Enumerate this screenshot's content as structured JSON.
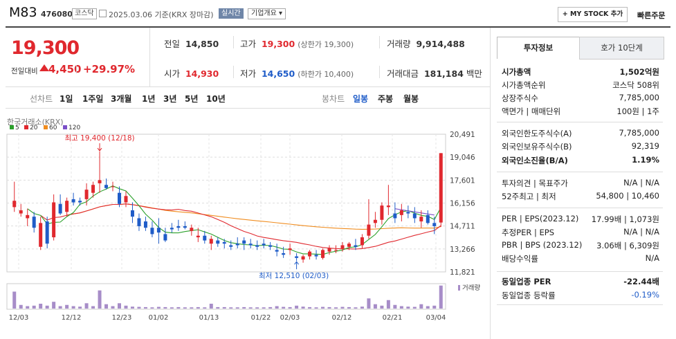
{
  "header": {
    "name": "M83",
    "code": "476080",
    "market": "코스닥",
    "date": "2025.03.06",
    "basis": "기준(KRX 장마감)",
    "realtime": "실시간",
    "company_info": "기업개요",
    "my_stock": "+ MY STOCK 추가",
    "quick_order": "빠른주문"
  },
  "price": {
    "current": "19,300",
    "change_label": "전일대비",
    "change": "4,450",
    "percent": "+29.97%"
  },
  "stats": {
    "prev_label": "전일",
    "prev": "14,850",
    "high_label": "고가",
    "high": "19,300",
    "high_limit": "(상한가 19,300)",
    "vol_label": "거래량",
    "vol": "9,914,488",
    "open_label": "시가",
    "open": "14,930",
    "low_label": "저가",
    "low": "14,650",
    "low_limit": "(하한가 10,400)",
    "amt_label": "거래대금",
    "amt": "181,184",
    "amt_unit": "백만"
  },
  "periods": {
    "left": [
      "선차트",
      "1일",
      "1주일",
      "3개월",
      "1년",
      "3년",
      "5년",
      "10년"
    ],
    "right": [
      "봉차트",
      "일봉",
      "주봉",
      "월봉"
    ]
  },
  "chart_legend": "한국거래소(KRX)",
  "chart_data": {
    "type": "candlestick",
    "ma": [
      {
        "name": "5",
        "color": "#2aa02a"
      },
      {
        "name": "20",
        "color": "#e0282e"
      },
      {
        "name": "60",
        "color": "#f08c1e"
      },
      {
        "name": "120",
        "color": "#7b4fc8"
      }
    ],
    "y_ticks": [
      "20,491",
      "19,046",
      "17,601",
      "16,156",
      "14,711",
      "13,266",
      "11,821"
    ],
    "x_ticks": [
      "12/03",
      "12/12",
      "12/23",
      "01/02",
      "01/13",
      "01/22",
      "02/03",
      "02/12",
      "02/21",
      "03/04"
    ],
    "high_note": "최고 19,400 (12/18)",
    "low_note": "최저 12,510 (02/03)",
    "volume_label": "거래량",
    "ylim": [
      11821,
      20491
    ],
    "candles": [
      [
        15900,
        17500,
        15600,
        16300
      ],
      [
        15500,
        16100,
        15300,
        15700
      ],
      [
        15200,
        15800,
        14700,
        15400
      ],
      [
        15300,
        15600,
        14300,
        14600
      ],
      [
        13400,
        15300,
        13200,
        14900
      ],
      [
        15000,
        15300,
        13300,
        13600
      ],
      [
        14000,
        16700,
        13800,
        16200
      ],
      [
        16100,
        16700,
        15400,
        15500
      ],
      [
        15600,
        16500,
        15300,
        16300
      ],
      [
        16400,
        16800,
        16000,
        16200
      ],
      [
        16300,
        16500,
        16000,
        16200
      ],
      [
        16400,
        17400,
        16000,
        17000
      ],
      [
        16800,
        17500,
        16500,
        17300
      ],
      [
        17400,
        19400,
        16800,
        17600
      ],
      [
        17300,
        17700,
        17000,
        17100
      ],
      [
        17200,
        17500,
        16900,
        17200
      ],
      [
        16800,
        17200,
        15900,
        16100
      ],
      [
        16200,
        16900,
        15900,
        16600
      ],
      [
        15700,
        16200,
        14900,
        15300
      ],
      [
        15200,
        15500,
        14400,
        14700
      ],
      [
        15000,
        15300,
        14400,
        14600
      ],
      [
        14600,
        15000,
        14000,
        14200
      ],
      [
        14600,
        15200,
        13600,
        14300
      ],
      [
        14200,
        14600,
        13700,
        13800
      ],
      [
        14600,
        14900,
        14300,
        14500
      ],
      [
        14700,
        15100,
        14400,
        14600
      ],
      [
        14700,
        15000,
        14500,
        14600
      ],
      [
        14400,
        14800,
        14100,
        14600
      ],
      [
        14000,
        14600,
        13700,
        14100
      ],
      [
        14100,
        14400,
        13600,
        13800
      ],
      [
        13600,
        14100,
        13200,
        13900
      ],
      [
        13800,
        14000,
        13400,
        13600
      ],
      [
        13700,
        13900,
        13300,
        13600
      ],
      [
        13500,
        13800,
        13200,
        13400
      ],
      [
        13600,
        14000,
        13300,
        13500
      ],
      [
        13800,
        14000,
        13200,
        13600
      ],
      [
        13600,
        13900,
        13300,
        13500
      ],
      [
        13500,
        13800,
        13200,
        13400
      ],
      [
        13600,
        13900,
        13300,
        13500
      ],
      [
        13500,
        13700,
        13200,
        13400
      ],
      [
        13200,
        13600,
        12800,
        13100
      ],
      [
        13000,
        13400,
        12700,
        12900
      ],
      [
        13200,
        13600,
        12900,
        13300
      ],
      [
        12800,
        13000,
        12510,
        12700
      ],
      [
        12600,
        12900,
        12400,
        12800
      ],
      [
        12800,
        13200,
        12600,
        13100
      ],
      [
        12900,
        13200,
        12600,
        12800
      ],
      [
        12700,
        13300,
        12600,
        13200
      ],
      [
        13100,
        13500,
        12900,
        13300
      ],
      [
        13200,
        13500,
        13000,
        13200
      ],
      [
        13300,
        13700,
        13100,
        13500
      ],
      [
        13400,
        13700,
        13200,
        13600
      ],
      [
        13500,
        13900,
        13200,
        13400
      ],
      [
        13500,
        14200,
        13300,
        14000
      ],
      [
        14100,
        16400,
        13900,
        14800
      ],
      [
        14900,
        15600,
        14600,
        15100
      ],
      [
        15100,
        16200,
        14800,
        16000
      ],
      [
        15900,
        17300,
        15400,
        16000
      ],
      [
        15500,
        16200,
        14900,
        15200
      ],
      [
        15400,
        16100,
        15000,
        15700
      ],
      [
        15600,
        16000,
        15200,
        15500
      ],
      [
        15500,
        15900,
        14900,
        15200
      ],
      [
        15000,
        15700,
        14600,
        15300
      ],
      [
        15400,
        15700,
        14800,
        14900
      ],
      [
        14900,
        15300,
        14200,
        14700
      ],
      [
        14930,
        19300,
        14650,
        19300
      ]
    ]
  },
  "panel": {
    "tab_on": "투자정보",
    "tab_off": "호가 10단계",
    "rows": [
      {
        "l": "시가총액",
        "r": "1,502억원",
        "bold": true
      },
      {
        "l": "시가총액순위",
        "r": "코스닥 508위"
      },
      {
        "l": "상장주식수",
        "r": "7,785,000"
      },
      {
        "l": "액면가 | 매매단위",
        "r": "100원 | 1주"
      },
      {
        "l": "외국인한도주식수(A)",
        "r": "7,785,000"
      },
      {
        "l": "외국인보유주식수(B)",
        "r": "92,319"
      },
      {
        "l": "외국인소진율(B/A)",
        "r": "1.19%",
        "bold": true
      },
      {
        "l": "투자의견 | 목표주가",
        "r": "N/A | N/A"
      },
      {
        "l": "52주최고 | 최저",
        "r": "54,800 | 10,460"
      },
      {
        "l": "PER | EPS(2023.12)",
        "r": "17.99배 | 1,073원"
      },
      {
        "l": "추정PER | EPS",
        "r": "N/A | N/A"
      },
      {
        "l": "PBR | BPS (2023.12)",
        "r": "3.06배 | 6,309원"
      },
      {
        "l": "배당수익률",
        "r": "N/A"
      },
      {
        "l": "동일업종 PER",
        "r": "-22.44배",
        "bold": true
      },
      {
        "l": "동일업종 등락률",
        "r": "-0.19%",
        "blue": true
      }
    ]
  }
}
